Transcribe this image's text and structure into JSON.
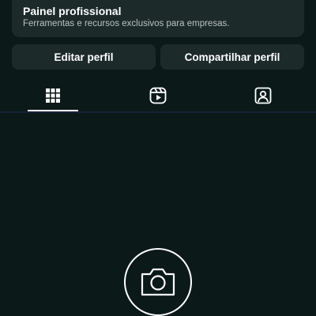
{
  "professional_panel": {
    "title": "Painel profissional",
    "subtitle": "Ferramentas e recursos exclusivos para empresas."
  },
  "actions": {
    "edit_profile_label": "Editar perfil",
    "share_profile_label": "Compartilhar perfil"
  },
  "tabs": [
    {
      "icon": "grid-icon",
      "active": true
    },
    {
      "icon": "reels-icon",
      "active": false
    },
    {
      "icon": "tagged-icon",
      "active": false
    }
  ],
  "empty_state": {
    "icon": "camera-icon"
  },
  "colors": {
    "background": "#0b1a19",
    "card": "#1d2a2a",
    "text_primary": "#ffffff",
    "text_secondary": "#b9c2c1",
    "divider": "#1a1f3a"
  }
}
